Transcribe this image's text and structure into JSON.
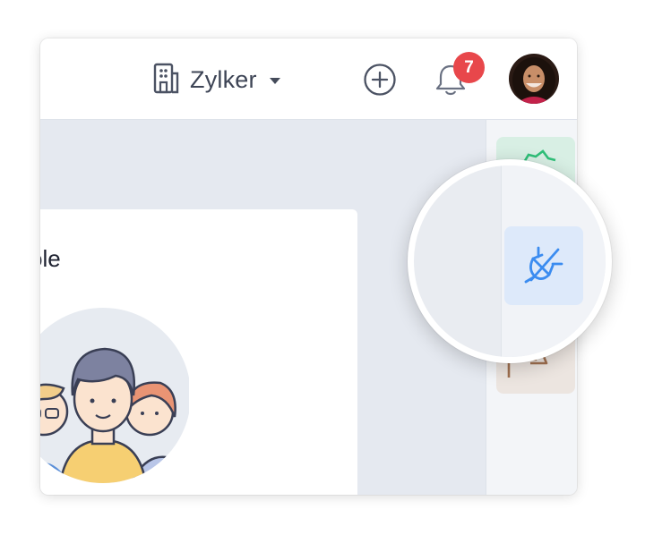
{
  "header": {
    "org_name": "Zylker",
    "notification_count": "7"
  },
  "card": {
    "title_fragment": "ole"
  },
  "icons": {
    "org": "building-icon",
    "add": "plus-circle-icon",
    "bell": "bell-icon",
    "plug": "plug-disconnect-icon",
    "settings": "gear-icon",
    "flag": "flag-icon"
  },
  "colors": {
    "accent_blue": "#3b8cf0",
    "badge_red": "#e8474b",
    "tile_green": "#d8efe4",
    "tile_blue": "#dce9f9",
    "tile_brown": "#ece5e0"
  }
}
